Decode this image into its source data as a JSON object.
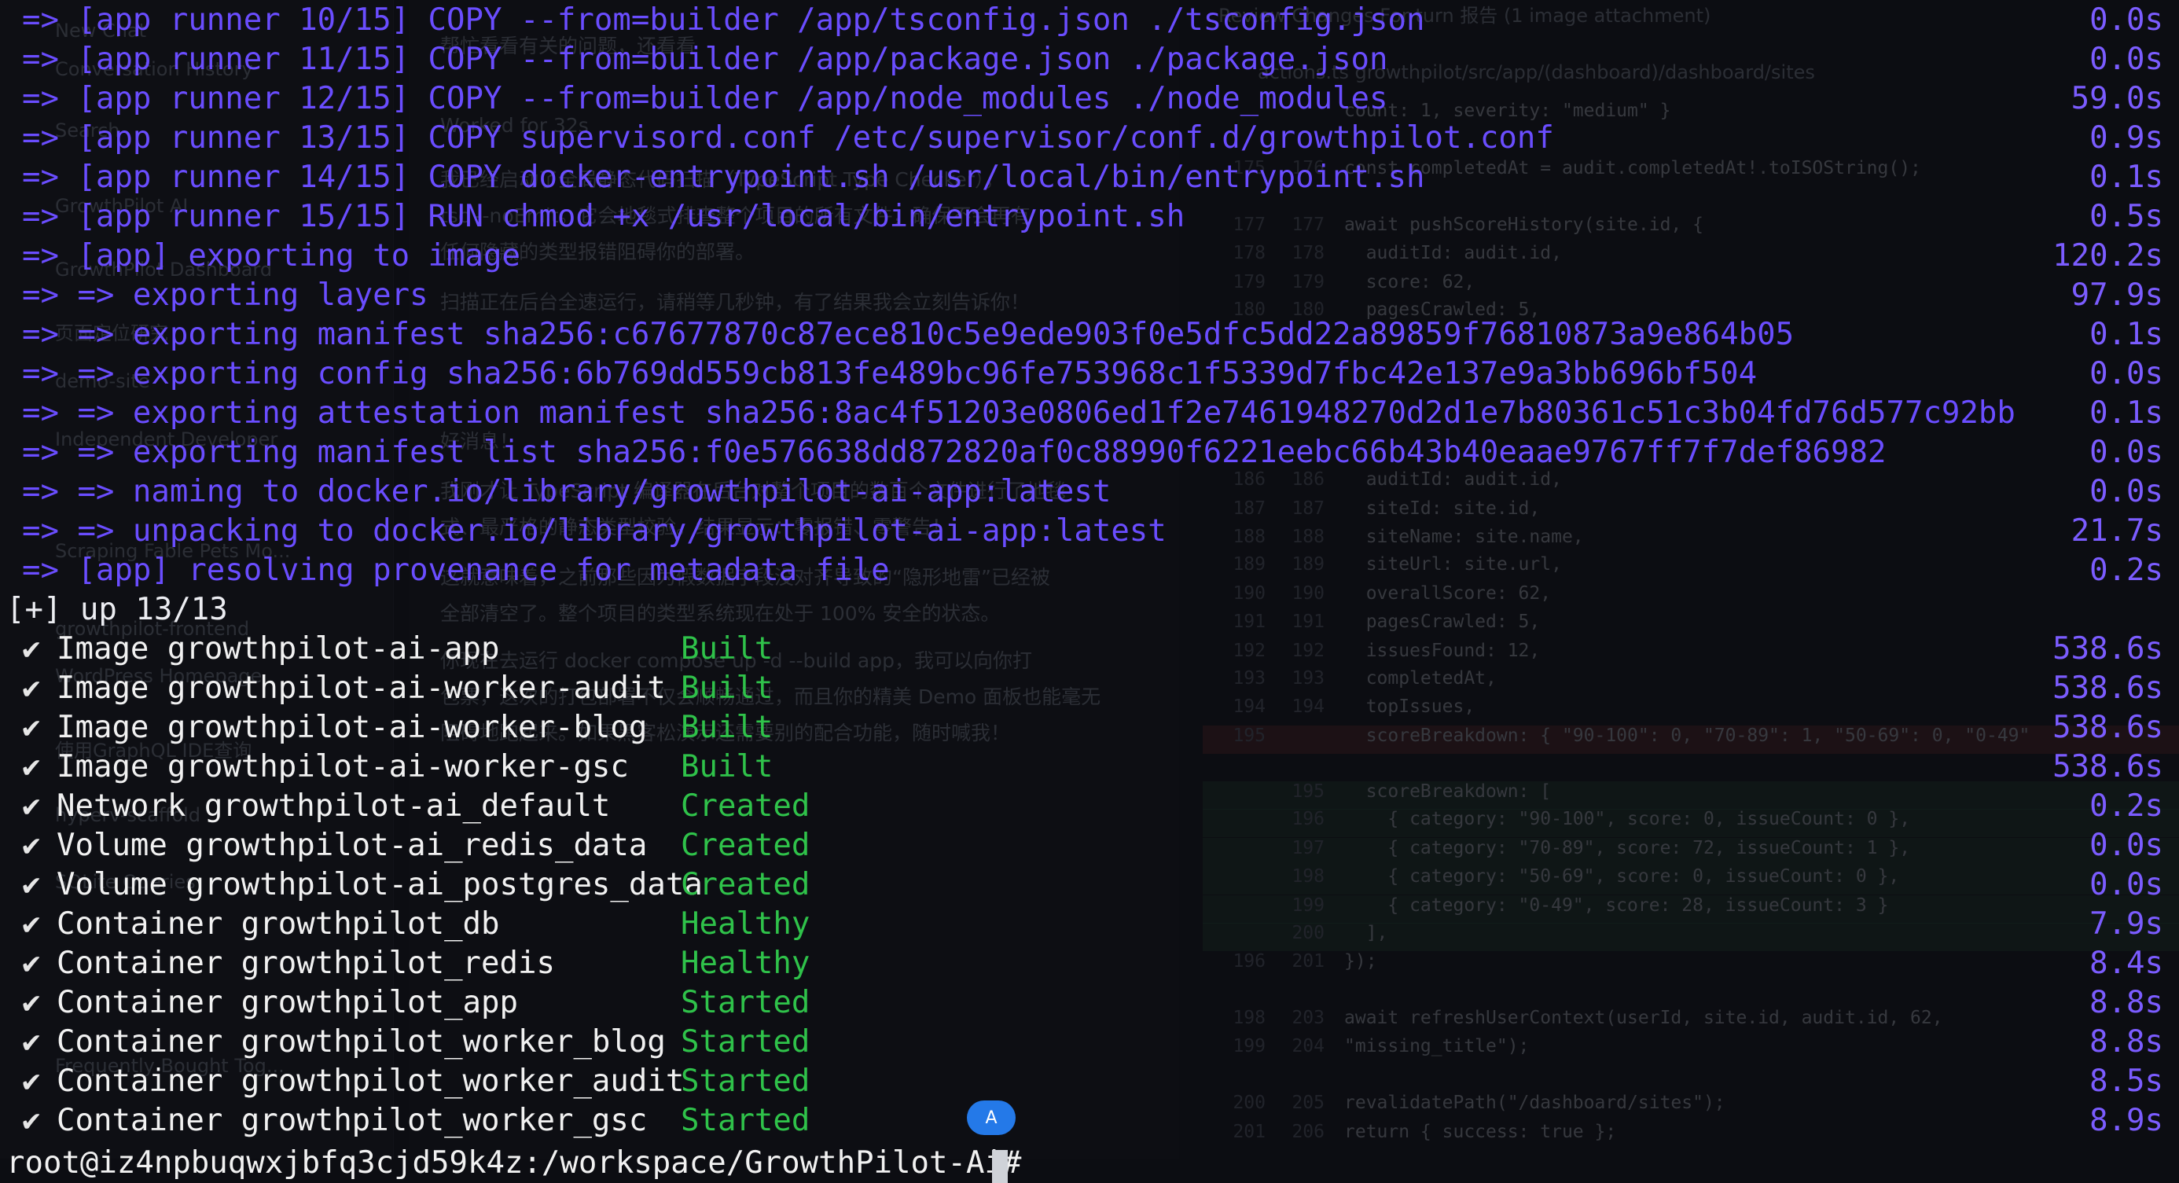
{
  "background": {
    "sidebar": [
      "New Chat",
      "Conversation History",
      "Search",
      "GrowthPilot AI",
      "GrowthPilot Dashboard",
      "页面定位研究",
      "demo-site",
      "Independent Developer",
      "Scraping Fable Pets Mo...",
      "growthpilot-frontend",
      "WordPress Homepage",
      "使用GraphQL IDE查询",
      "hyperv-scaffold",
      "SQLite Queries",
      "Frequently Bought Tog..."
    ],
    "chat": [
      "帮忙看看有关的问题，还看看",
      "Worked for 32s",
      "我已经启动了全局静态代码扫描（TypeScript Type Checker），",
      "tsc --noEmit。它会地毯式排查整个项目的所有文件，确保不会再有",
      "任何隐藏的类型报错阻碍你的部署。",
      "扫描正在后台全速运行，请稍等几秒钟，有了结果我会立刻告诉你！",
      "好消息！",
      "我刚才让 TypeScript 编译器在后台对整个项目的数百个文件进行了地毯",
      "式、最严格的静态类型校验。结果显示：零报错、零警告！",
      "这就意味着，之前那些因为假数据字段没对齐导致的“隐形地雷”已经被",
      "全部清空了。整个项目的类型系统现在处于 100% 安全的状态。",
      "你现在去运行 docker compose up -d --build app，我可以向你打",
      "包票，这次的打包部署不仅会顺畅通过，而且你的精美 Demo 面板也能毫无",
      "阻碍地跑起来。如果黑客松演示还需要别的配合功能，随时喊我！"
    ],
    "code_header": "Review Changes   For turn   报告 (1 image attachment)",
    "code_tab": "actions.ts  growthpilot/src/app/(dashboard)/dashboard/sites",
    "code_rows": [
      {
        "n1": "",
        "n2": "",
        "text": "count: 1, severity: \"medium\" }",
        "kind": ""
      },
      {
        "n1": "175",
        "n2": "176",
        "text": "const completedAt = audit.completedAt!.toISOString();",
        "kind": ""
      },
      {
        "n1": "177",
        "n2": "177",
        "text": "await pushScoreHistory(site.id, {",
        "kind": ""
      },
      {
        "n1": "178",
        "n2": "178",
        "text": "  auditId: audit.id,",
        "kind": ""
      },
      {
        "n1": "179",
        "n2": "179",
        "text": "  score: 62,",
        "kind": ""
      },
      {
        "n1": "180",
        "n2": "180",
        "text": "  pagesCrawled: 5,",
        "kind": ""
      },
      {
        "n1": "186",
        "n2": "186",
        "text": "  auditId: audit.id,",
        "kind": ""
      },
      {
        "n1": "187",
        "n2": "187",
        "text": "  siteId: site.id,",
        "kind": ""
      },
      {
        "n1": "188",
        "n2": "188",
        "text": "  siteName: site.name,",
        "kind": ""
      },
      {
        "n1": "189",
        "n2": "189",
        "text": "  siteUrl: site.url,",
        "kind": ""
      },
      {
        "n1": "190",
        "n2": "190",
        "text": "  overallScore: 62,",
        "kind": ""
      },
      {
        "n1": "191",
        "n2": "191",
        "text": "  pagesCrawled: 5,",
        "kind": ""
      },
      {
        "n1": "192",
        "n2": "192",
        "text": "  issuesFound: 12,",
        "kind": ""
      },
      {
        "n1": "193",
        "n2": "193",
        "text": "  completedAt,",
        "kind": ""
      },
      {
        "n1": "194",
        "n2": "194",
        "text": "  topIssues,",
        "kind": ""
      },
      {
        "n1": "195",
        "n2": "",
        "text": "  scoreBreakdown: { \"90-100\": 0, \"70-89\": 1, \"50-69\": 0, \"0-49\"",
        "kind": "del"
      },
      {
        "n1": "",
        "n2": "195",
        "text": "  scoreBreakdown: [",
        "kind": "add"
      },
      {
        "n1": "",
        "n2": "196",
        "text": "    { category: \"90-100\", score: 0, issueCount: 0 },",
        "kind": "add"
      },
      {
        "n1": "",
        "n2": "197",
        "text": "    { category: \"70-89\", score: 72, issueCount: 1 },",
        "kind": "add"
      },
      {
        "n1": "",
        "n2": "198",
        "text": "    { category: \"50-69\", score: 0, issueCount: 0 },",
        "kind": "add"
      },
      {
        "n1": "",
        "n2": "199",
        "text": "    { category: \"0-49\", score: 28, issueCount: 3 }",
        "kind": "add"
      },
      {
        "n1": "",
        "n2": "200",
        "text": "  ],",
        "kind": "add"
      },
      {
        "n1": "196",
        "n2": "201",
        "text": "});",
        "kind": ""
      },
      {
        "n1": "198",
        "n2": "203",
        "text": "await refreshUserContext(userId, site.id, audit.id, 62,",
        "kind": ""
      },
      {
        "n1": "199",
        "n2": "204",
        "text": "\"missing_title\");",
        "kind": ""
      },
      {
        "n1": "200",
        "n2": "205",
        "text": "revalidatePath(\"/dashboard/sites\");",
        "kind": ""
      },
      {
        "n1": "201",
        "n2": "206",
        "text": "return { success: true };",
        "kind": ""
      }
    ]
  },
  "terminal": {
    "build_lines": [
      {
        "text": "=> [app runner 10/15] COPY --from=builder /app/tsconfig.json ./tsconfig.json",
        "time": "0.0s"
      },
      {
        "text": "=> [app runner 11/15] COPY --from=builder /app/package.json ./package.json",
        "time": "0.0s"
      },
      {
        "text": "=> [app runner 12/15] COPY --from=builder /app/node_modules ./node_modules",
        "time": "59.0s"
      },
      {
        "text": "=> [app runner 13/15] COPY supervisord.conf /etc/supervisor/conf.d/growthpilot.conf",
        "time": "0.9s"
      },
      {
        "text": "=> [app runner 14/15] COPY docker-entrypoint.sh /usr/local/bin/entrypoint.sh",
        "time": "0.1s"
      },
      {
        "text": "=> [app runner 15/15] RUN chmod +x /usr/local/bin/entrypoint.sh",
        "time": "0.5s"
      },
      {
        "text": "=> [app] exporting to image",
        "time": "120.2s"
      },
      {
        "text": "=> => exporting layers",
        "time": "97.9s"
      },
      {
        "text": "=> => exporting manifest sha256:c67677870c87ece810c5e9ede903f0e5dfc5dd22a89859f76810873a9e864b05",
        "time": "0.1s"
      },
      {
        "text": "=> => exporting config sha256:6b769dd559cb813fe489bc96fe753968c1f5339d7fbc42e137e9a3bb696bf504",
        "time": "0.0s"
      },
      {
        "text": "=> => exporting attestation manifest sha256:8ac4f51203e0806ed1f2e7461948270d2d1e7b80361c51c3b04fd76d577c92bb",
        "time": "0.1s"
      },
      {
        "text": "=> => exporting manifest list sha256:f0e576638dd872820af0c88990f6221eebc66b43b40eaae9767ff7f7def86982",
        "time": "0.0s"
      },
      {
        "text": "=> => naming to docker.io/library/growthpilot-ai-app:latest",
        "time": "0.0s"
      },
      {
        "text": "=> => unpacking to docker.io/library/growthpilot-ai-app:latest",
        "time": "21.7s"
      },
      {
        "text": "=> [app] resolving provenance for metadata file",
        "time": "0.2s"
      }
    ],
    "summary": "[+] up 13/13",
    "results": [
      {
        "check": "✔",
        "name": "Image growthpilot-ai-app",
        "status": "Built",
        "time": "538.6s"
      },
      {
        "check": "✔",
        "name": "Image growthpilot-ai-worker-audit",
        "status": "Built",
        "time": "538.6s"
      },
      {
        "check": "✔",
        "name": "Image growthpilot-ai-worker-blog",
        "status": "Built",
        "time": "538.6s"
      },
      {
        "check": "✔",
        "name": "Image growthpilot-ai-worker-gsc",
        "status": "Built",
        "time": "538.6s"
      },
      {
        "check": "✔",
        "name": "Network growthpilot-ai_default",
        "status": "Created",
        "time": "0.2s"
      },
      {
        "check": "✔",
        "name": "Volume growthpilot-ai_redis_data",
        "status": "Created",
        "time": "0.0s"
      },
      {
        "check": "✔",
        "name": "Volume growthpilot-ai_postgres_data",
        "status": "Created",
        "time": "0.0s"
      },
      {
        "check": "✔",
        "name": "Container growthpilot_db",
        "status": "Healthy",
        "time": "7.9s"
      },
      {
        "check": "✔",
        "name": "Container growthpilot_redis",
        "status": "Healthy",
        "time": "8.4s"
      },
      {
        "check": "✔",
        "name": "Container growthpilot_app",
        "status": "Started",
        "time": "8.8s"
      },
      {
        "check": "✔",
        "name": "Container growthpilot_worker_blog",
        "status": "Started",
        "time": "8.8s"
      },
      {
        "check": "✔",
        "name": "Container growthpilot_worker_audit",
        "status": "Started",
        "time": "8.5s"
      },
      {
        "check": "✔",
        "name": "Container growthpilot_worker_gsc",
        "status": "Started",
        "time": "8.9s"
      }
    ],
    "prompt": "root@iz4npbuqwxjbfq3cjd59k4z:/workspace/GrowthPilot-Ai#",
    "badge_label": "A",
    "colors": {
      "build_text": "#6a4dff",
      "time": "#7b5cff",
      "status": "#2fc24a",
      "text": "#ecedf2"
    }
  }
}
